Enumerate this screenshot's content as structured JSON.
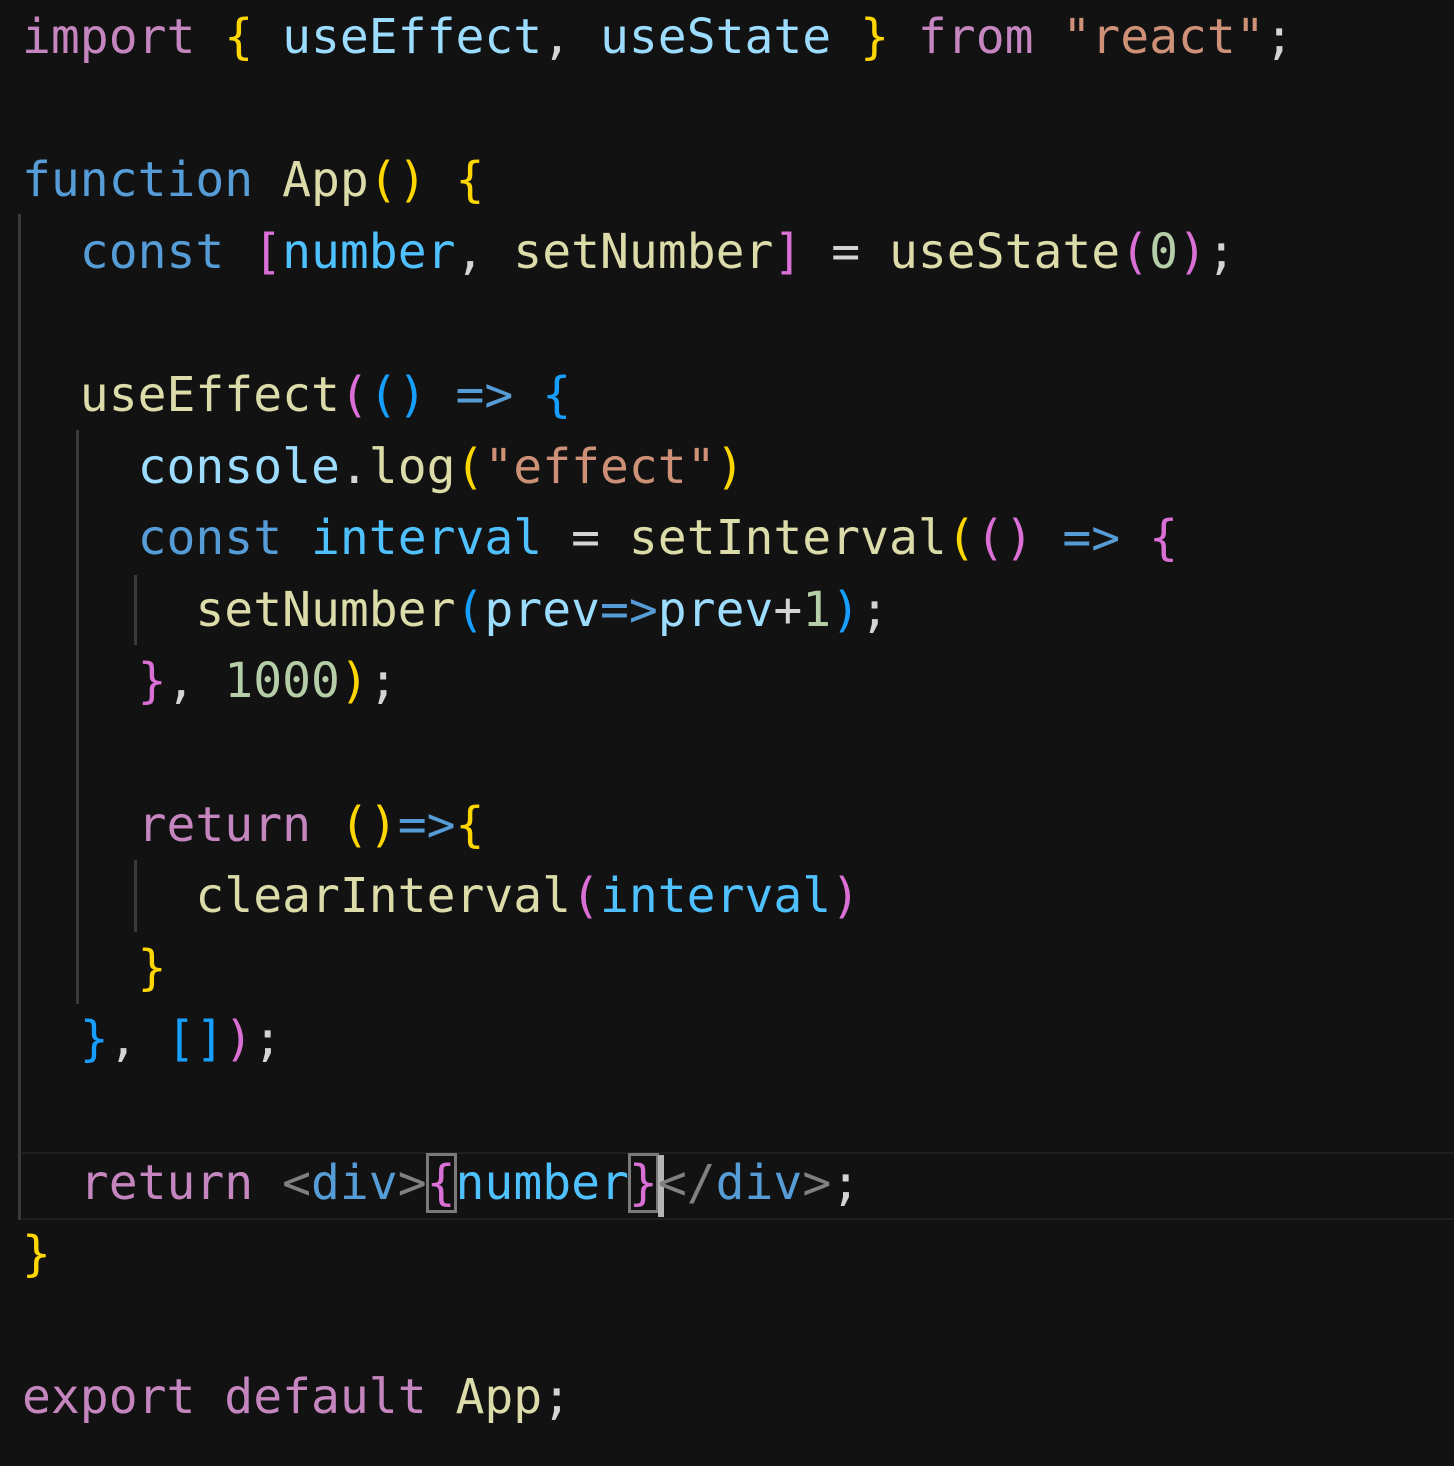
{
  "colors": {
    "background": "#121212",
    "keyword_control": "#c586c0",
    "keyword_storage": "#569cd6",
    "variable": "#9cdcfe",
    "function": "#dcdcaa",
    "string": "#ce9178",
    "number": "#b5cea8",
    "bracket_gold": "#ffd700",
    "bracket_magenta": "#da70d6",
    "bracket_blue": "#179fff",
    "punctuation": "#d4d4d4",
    "jsx_tag": "#569cd6",
    "jsx_angle": "#808080",
    "indent_guide": "#3a3a3a"
  },
  "code": {
    "lines": [
      [
        {
          "text": "import",
          "color": "#c586c0"
        },
        {
          "text": " "
        },
        {
          "text": "{",
          "color": "#ffd700"
        },
        {
          "text": " "
        },
        {
          "text": "useEffect",
          "color": "#9cdcfe"
        },
        {
          "text": ", "
        },
        {
          "text": "useState",
          "color": "#9cdcfe"
        },
        {
          "text": " "
        },
        {
          "text": "}",
          "color": "#ffd700"
        },
        {
          "text": " "
        },
        {
          "text": "from",
          "color": "#c586c0"
        },
        {
          "text": " "
        },
        {
          "text": "\"react\"",
          "color": "#ce9178"
        },
        {
          "text": ";"
        }
      ],
      [],
      [
        {
          "text": "function",
          "color": "#569cd6"
        },
        {
          "text": " "
        },
        {
          "text": "App",
          "color": "#dcdcaa"
        },
        {
          "text": "()",
          "color": "#ffd700"
        },
        {
          "text": " "
        },
        {
          "text": "{",
          "color": "#ffd700"
        }
      ],
      [
        {
          "text": "  "
        },
        {
          "text": "const",
          "color": "#569cd6"
        },
        {
          "text": " "
        },
        {
          "text": "[",
          "color": "#da70d6"
        },
        {
          "text": "number",
          "color": "#4fc1ff"
        },
        {
          "text": ", "
        },
        {
          "text": "setNumber",
          "color": "#dcdcaa"
        },
        {
          "text": "]",
          "color": "#da70d6"
        },
        {
          "text": " = "
        },
        {
          "text": "useState",
          "color": "#dcdcaa"
        },
        {
          "text": "(",
          "color": "#da70d6"
        },
        {
          "text": "0",
          "color": "#b5cea8"
        },
        {
          "text": ")",
          "color": "#da70d6"
        },
        {
          "text": ";"
        }
      ],
      [],
      [
        {
          "text": "  "
        },
        {
          "text": "useEffect",
          "color": "#dcdcaa"
        },
        {
          "text": "(",
          "color": "#da70d6"
        },
        {
          "text": "()",
          "color": "#179fff"
        },
        {
          "text": " "
        },
        {
          "text": "=>",
          "color": "#569cd6"
        },
        {
          "text": " "
        },
        {
          "text": "{",
          "color": "#179fff"
        }
      ],
      [
        {
          "text": "    "
        },
        {
          "text": "console",
          "color": "#9cdcfe"
        },
        {
          "text": "."
        },
        {
          "text": "log",
          "color": "#dcdcaa"
        },
        {
          "text": "(",
          "color": "#ffd700"
        },
        {
          "text": "\"effect\"",
          "color": "#ce9178"
        },
        {
          "text": ")",
          "color": "#ffd700"
        }
      ],
      [
        {
          "text": "    "
        },
        {
          "text": "const",
          "color": "#569cd6"
        },
        {
          "text": " "
        },
        {
          "text": "interval",
          "color": "#4fc1ff"
        },
        {
          "text": " = "
        },
        {
          "text": "setInterval",
          "color": "#dcdcaa"
        },
        {
          "text": "(",
          "color": "#ffd700"
        },
        {
          "text": "()",
          "color": "#da70d6"
        },
        {
          "text": " "
        },
        {
          "text": "=>",
          "color": "#569cd6"
        },
        {
          "text": " "
        },
        {
          "text": "{",
          "color": "#da70d6"
        }
      ],
      [
        {
          "text": "      "
        },
        {
          "text": "setNumber",
          "color": "#dcdcaa"
        },
        {
          "text": "(",
          "color": "#179fff"
        },
        {
          "text": "prev",
          "color": "#9cdcfe"
        },
        {
          "text": "=>",
          "color": "#569cd6"
        },
        {
          "text": "prev",
          "color": "#9cdcfe"
        },
        {
          "text": "+"
        },
        {
          "text": "1",
          "color": "#b5cea8"
        },
        {
          "text": ")",
          "color": "#179fff"
        },
        {
          "text": ";"
        }
      ],
      [
        {
          "text": "    "
        },
        {
          "text": "}",
          "color": "#da70d6"
        },
        {
          "text": ", "
        },
        {
          "text": "1000",
          "color": "#b5cea8"
        },
        {
          "text": ")",
          "color": "#ffd700"
        },
        {
          "text": ";"
        }
      ],
      [],
      [
        {
          "text": "    "
        },
        {
          "text": "return",
          "color": "#c586c0"
        },
        {
          "text": " "
        },
        {
          "text": "()",
          "color": "#ffd700"
        },
        {
          "text": "=>",
          "color": "#569cd6"
        },
        {
          "text": "{",
          "color": "#ffd700"
        }
      ],
      [
        {
          "text": "      "
        },
        {
          "text": "clearInterval",
          "color": "#dcdcaa"
        },
        {
          "text": "(",
          "color": "#da70d6"
        },
        {
          "text": "interval",
          "color": "#4fc1ff"
        },
        {
          "text": ")",
          "color": "#da70d6"
        }
      ],
      [
        {
          "text": "    "
        },
        {
          "text": "}",
          "color": "#ffd700"
        }
      ],
      [
        {
          "text": "  "
        },
        {
          "text": "}",
          "color": "#179fff"
        },
        {
          "text": ", "
        },
        {
          "text": "[]",
          "color": "#179fff"
        },
        {
          "text": ")",
          "color": "#da70d6"
        },
        {
          "text": ";"
        }
      ],
      [],
      [
        {
          "text": "  "
        },
        {
          "text": "return",
          "color": "#c586c0"
        },
        {
          "text": " "
        },
        {
          "text": "<",
          "color": "#808080"
        },
        {
          "text": "div",
          "color": "#569cd6"
        },
        {
          "text": ">",
          "color": "#808080"
        },
        {
          "text": "{",
          "color": "#da70d6",
          "match": true
        },
        {
          "text": "number",
          "color": "#4fc1ff"
        },
        {
          "text": "}",
          "color": "#da70d6",
          "match": true,
          "cursor": true
        },
        {
          "text": "</",
          "color": "#808080"
        },
        {
          "text": "div",
          "color": "#569cd6"
        },
        {
          "text": ">",
          "color": "#808080"
        },
        {
          "text": ";"
        }
      ],
      [
        {
          "text": "}",
          "color": "#ffd700"
        }
      ],
      [],
      [
        {
          "text": "export",
          "color": "#c586c0"
        },
        {
          "text": " "
        },
        {
          "text": "default",
          "color": "#c586c0"
        },
        {
          "text": " "
        },
        {
          "text": "App",
          "color": "#dcdcaa"
        },
        {
          "text": ";"
        }
      ]
    ]
  }
}
